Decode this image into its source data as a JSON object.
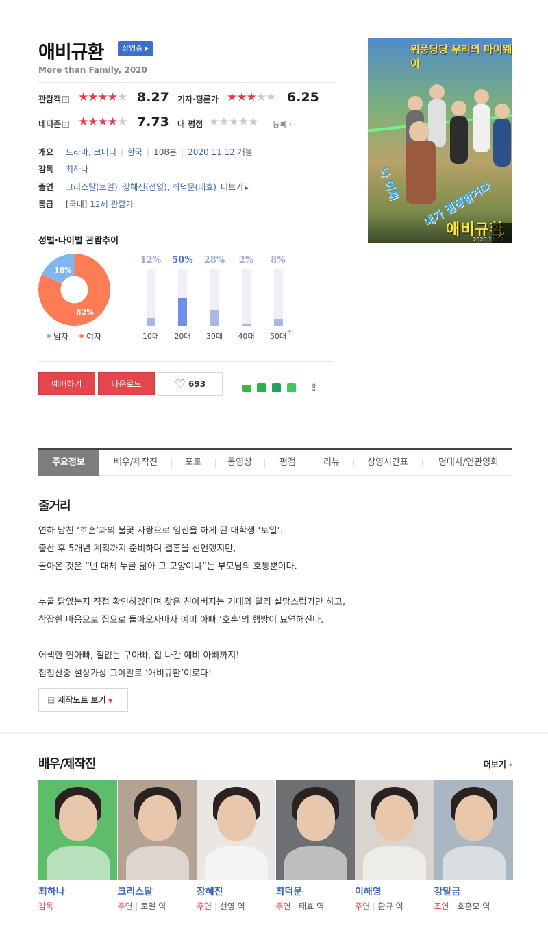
{
  "movie": {
    "title": "애비규환",
    "status_badge": "상영중",
    "subtitle": "More than Family, 2020",
    "ratings": {
      "audience": {
        "label": "관람객",
        "score": "8.27",
        "stars": 4
      },
      "critic": {
        "label": "기자·평론가",
        "score": "6.25",
        "stars": 3
      },
      "netizen": {
        "label": "네티즌",
        "score": "7.73",
        "stars": 4
      },
      "my": {
        "label": "내 평점",
        "register": "등록"
      }
    },
    "info": {
      "overview_label": "개요",
      "genre1": "드라마",
      "genre2": "코미디",
      "country": "한국",
      "runtime": "108분",
      "release": "2020.11.12",
      "release_suffix": " 개봉",
      "director_label": "감독",
      "director": "최하나",
      "cast_label": "출연",
      "cast_text": "크리스탈(토일), 장혜진(선영), 최덕문(태효)",
      "cast_more": "더보기",
      "grade_label": "등급",
      "grade_prefix": "[국내]",
      "grade": "12세 관람가"
    },
    "poster": {
      "tagline": "위풍당당 우리의 마이웨이",
      "title": "애비규환",
      "date": "2020.11.12",
      "zoom_icon": "search-icon"
    }
  },
  "audience_trend": {
    "title": "성별·나이별 관람추이",
    "gender": {
      "male_pct": "18%",
      "female_pct": "82%",
      "male_value": 18,
      "female_value": 82,
      "male_label": "남자",
      "female_label": "여자",
      "male_color": "#7fb6f2",
      "female_color": "#ff7c55"
    },
    "ages": [
      {
        "label": "10대",
        "pct": "12%",
        "value": 12
      },
      {
        "label": "20대",
        "pct": "50%",
        "value": 50,
        "highlight": true
      },
      {
        "label": "30대",
        "pct": "28%",
        "value": 28
      },
      {
        "label": "40대",
        "pct": "2%",
        "value": 2
      },
      {
        "label": "50대",
        "pct": "8%",
        "value": 8
      }
    ]
  },
  "actions": {
    "reserve": "예매하기",
    "download": "다운로드",
    "likes": "693"
  },
  "tabs": [
    "주요정보",
    "배우/제작진",
    "포토",
    "동영상",
    "평점",
    "리뷰",
    "상영시간표",
    "명대사/연관영화"
  ],
  "synopsis": {
    "title": "줄거리",
    "lines": [
      "연하 남친 ‘호훈’과의 불꽃 사랑으로 임신을 하게 된 대학생 ‘토일’.",
      " 출산 후 5개년 계획까지 준비하며 결혼을 선언했지만,",
      " 돌아온 것은 “넌 대체 누굴 닮아 그 모양이냐”는 부모님의 호통뿐이다.",
      "",
      " 누굴 닮았는지 직접 확인하겠다며 찾은 친아버지는 기대와 달리 실망스럽기만 하고,",
      " 착잡한 마음으로 집으로 돌아오자마자 예비 아빠 ‘호훈’의 행방이 묘연해진다.",
      "",
      " 어색한 현아빠, 철없는 구아빠, 집 나간 예비 아빠까지!",
      " 첩첩산중 설상가상 그야말로 ‘애비규환’이로다!"
    ],
    "notes_button": "제작노트 보기"
  },
  "cast_section": {
    "title": "배우/제작진",
    "more": "더보기",
    "people": [
      {
        "name": "최하나",
        "role": "감독",
        "char": "",
        "photo_bg": "#5dbd6a"
      },
      {
        "name": "크리스탈",
        "role": "주연",
        "char": "토일 역",
        "photo_bg": "#b4a293"
      },
      {
        "name": "장혜진",
        "role": "주연",
        "char": "선영 역",
        "photo_bg": "#e9e6e3"
      },
      {
        "name": "최덕문",
        "role": "주연",
        "char": "태효 역",
        "photo_bg": "#6d7073"
      },
      {
        "name": "이해영",
        "role": "주연",
        "char": "환규 역",
        "photo_bg": "#d9d4cf"
      },
      {
        "name": "강말금",
        "role": "조연",
        "char": "호훈모 역",
        "photo_bg": "#aab6c2"
      }
    ]
  }
}
